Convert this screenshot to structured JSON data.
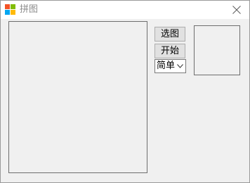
{
  "window": {
    "title": "拼图",
    "app_icon": "windows-logo-icon",
    "close_icon": "close-icon"
  },
  "controls": {
    "select_image_label": "选图",
    "start_label": "开始",
    "difficulty": {
      "selected": "简单",
      "arrow_icon": "chevron-down-icon"
    }
  }
}
